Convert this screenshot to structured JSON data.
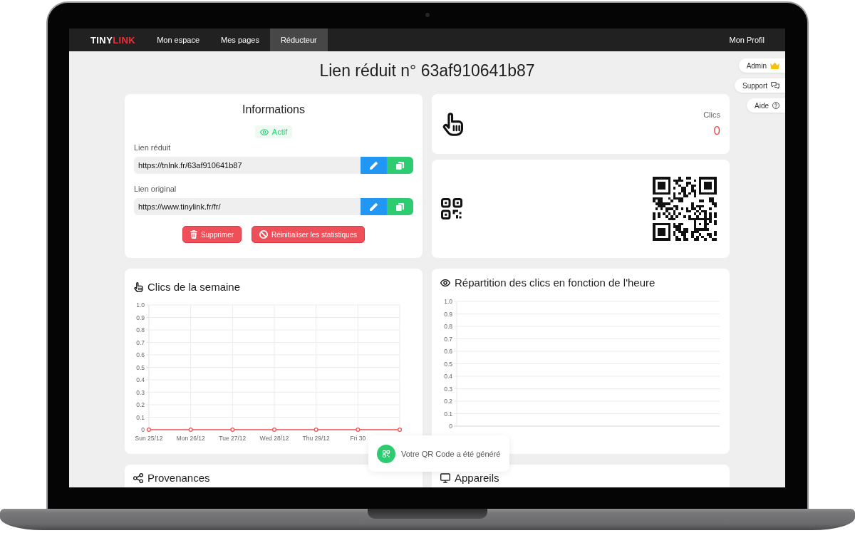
{
  "navbar": {
    "logo": {
      "text": "TINY",
      "accent": "LINK"
    },
    "items": [
      {
        "label": "Mon espace",
        "selected": false
      },
      {
        "label": "Mes pages",
        "selected": false
      },
      {
        "label": "Réducteur",
        "selected": true
      }
    ],
    "profile": "Mon Profil"
  },
  "side_buttons": [
    {
      "label": "Admin",
      "kind": "admin"
    },
    {
      "label": "Support",
      "kind": "support"
    },
    {
      "label": "Aide",
      "kind": "help"
    }
  ],
  "page_title": "Lien réduit n° 63af910641b87",
  "info_card": {
    "title": "Informations",
    "status": {
      "label": "Actif",
      "active": true
    },
    "fields": [
      {
        "label": "Lien réduit",
        "value": "https://tnlnk.fr/63af910641b87"
      },
      {
        "label": "Lien original",
        "value": "https://www.tinylink.fr/fr/"
      }
    ],
    "actions": [
      {
        "label": "Supprimer",
        "kind": "delete"
      },
      {
        "label": "Réinitialiser les statistiques",
        "kind": "reset"
      }
    ]
  },
  "clicks_card": {
    "label": "Clics",
    "value": "0"
  },
  "weekly_chart": {
    "title": "Clics de la semaine",
    "chart_data": {
      "type": "line",
      "grid": true,
      "categories": [
        "Sun 25/12",
        "Mon 26/12",
        "Tue 27/12",
        "Wed 28/12",
        "Thu 29/12",
        "Fri 30",
        null
      ],
      "series": [
        {
          "color": "#f05454",
          "marker": true,
          "values": [
            0,
            0,
            0,
            0,
            0,
            0,
            0
          ]
        }
      ],
      "ylim": [
        0,
        1
      ],
      "yticks": [
        0,
        0.1,
        0.2,
        0.3,
        0.4,
        0.5,
        0.6,
        0.7,
        0.8,
        0.9,
        {
          "value": 1,
          "label": "1.0"
        }
      ]
    }
  },
  "hourly_chart": {
    "title": "Répartition des clics en fonction de l'heure",
    "chart_data": {
      "type": "line",
      "grid": "y",
      "categories": [
        null,
        null,
        null,
        null,
        null,
        null,
        null,
        null,
        null,
        null,
        null,
        null,
        null,
        null,
        null,
        null,
        null,
        null,
        null,
        null,
        null,
        null,
        null,
        null
      ],
      "ylim": [
        0,
        1
      ],
      "yticks": [
        0,
        0.1,
        0.2,
        0.3,
        0.4,
        0.5,
        0.6,
        0.7,
        0.8,
        0.9,
        {
          "value": 1,
          "label": "1.0"
        }
      ]
    }
  },
  "bottom_cards": [
    {
      "title": "Provenances",
      "kind": "share"
    },
    {
      "title": "Appareils",
      "kind": "device"
    }
  ],
  "toast": {
    "message": "Votre QR Code a été généré"
  }
}
